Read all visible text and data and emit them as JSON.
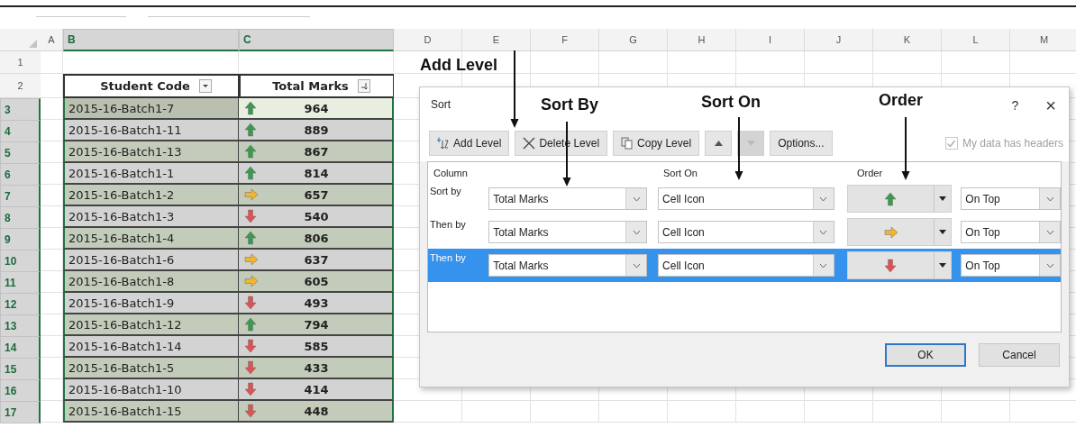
{
  "spreadsheet": {
    "column_headers": [
      "A",
      "B",
      "C",
      "D",
      "E",
      "F",
      "G",
      "H",
      "I",
      "J",
      "K",
      "L",
      "M"
    ],
    "row_headers": [
      "1",
      "2",
      "3",
      "4",
      "5",
      "6",
      "7",
      "8",
      "9",
      "10",
      "11",
      "12",
      "13",
      "14",
      "15",
      "16",
      "17"
    ],
    "table": {
      "columns": [
        {
          "label": "Student Code",
          "kind": "filter"
        },
        {
          "label": "Total Marks",
          "kind": "sorted"
        }
      ],
      "rows": [
        {
          "code": "2015-16-Batch1-7",
          "kind": "up",
          "marks": "964"
        },
        {
          "code": "2015-16-Batch1-11",
          "kind": "up",
          "marks": "889"
        },
        {
          "code": "2015-16-Batch1-13",
          "kind": "up",
          "marks": "867"
        },
        {
          "code": "2015-16-Batch1-1",
          "kind": "up",
          "marks": "814"
        },
        {
          "code": "2015-16-Batch1-2",
          "kind": "right",
          "marks": "657"
        },
        {
          "code": "2015-16-Batch1-3",
          "kind": "down",
          "marks": "540"
        },
        {
          "code": "2015-16-Batch1-4",
          "kind": "up",
          "marks": "806"
        },
        {
          "code": "2015-16-Batch1-6",
          "kind": "right",
          "marks": "637"
        },
        {
          "code": "2015-16-Batch1-8",
          "kind": "right",
          "marks": "605"
        },
        {
          "code": "2015-16-Batch1-9",
          "kind": "down",
          "marks": "493"
        },
        {
          "code": "2015-16-Batch1-12",
          "kind": "up",
          "marks": "794"
        },
        {
          "code": "2015-16-Batch1-14",
          "kind": "down",
          "marks": "585"
        },
        {
          "code": "2015-16-Batch1-5",
          "kind": "down",
          "marks": "433"
        },
        {
          "code": "2015-16-Batch1-10",
          "kind": "down",
          "marks": "414"
        },
        {
          "code": "2015-16-Batch1-15",
          "kind": "down",
          "marks": "448"
        }
      ]
    }
  },
  "dialog": {
    "title": "Sort",
    "help": "?",
    "close": "×",
    "toolbar": [
      {
        "kind": "add",
        "label": "Add Level",
        "disabled": false
      },
      {
        "kind": "delete",
        "label": "Delete Level",
        "disabled": false
      },
      {
        "kind": "copy",
        "label": "Copy Level",
        "disabled": false
      },
      {
        "kind": "move_up",
        "disabled": false
      },
      {
        "kind": "move_down",
        "disabled": true
      },
      {
        "kind": "text",
        "label": "Options...",
        "disabled": false
      }
    ],
    "headers_checkbox": {
      "label": "My data has headers",
      "checked": true,
      "disabled": true
    },
    "grid_headers": [
      "Column",
      "Sort On",
      "Order"
    ],
    "levels": [
      {
        "label": "Sort by",
        "column": "Total Marks",
        "sort_on": "Cell Icon",
        "kind": "up",
        "position": "On Top",
        "selected": false
      },
      {
        "label": "Then by",
        "column": "Total Marks",
        "sort_on": "Cell Icon",
        "kind": "right",
        "position": "On Top",
        "selected": false
      },
      {
        "label": "Then by",
        "column": "Total Marks",
        "sort_on": "Cell Icon",
        "kind": "down",
        "position": "On Top",
        "selected": true
      }
    ],
    "buttons": [
      {
        "label": "OK",
        "default": true
      },
      {
        "label": "Cancel",
        "default": false
      }
    ]
  },
  "annotations": [
    "Add Level",
    "Sort By",
    "Sort On",
    "Order"
  ]
}
